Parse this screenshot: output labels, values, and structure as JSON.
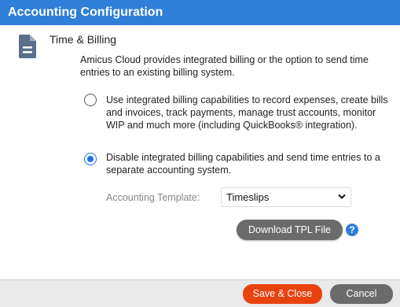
{
  "dialog": {
    "title": "Accounting Configuration"
  },
  "section": {
    "icon": "document-icon",
    "title": "Time & Billing",
    "description": "Amicus Cloud provides integrated billing or the option to send time entries to an existing billing system."
  },
  "options": [
    {
      "label": "Use integrated billing capabilities to record expenses, create bills and invoices, track payments, manage trust accounts, monitor WIP and much more (including QuickBooks® integration).",
      "selected": false
    },
    {
      "label": "Disable integrated billing capabilities and send time entries to a separate accounting system.",
      "selected": true
    }
  ],
  "template": {
    "label": "Accounting Template:",
    "value": "Timeslips"
  },
  "download_button": "Download TPL File",
  "help_icon": "?",
  "footer": {
    "save_label": "Save & Close",
    "cancel_label": "Cancel"
  },
  "colors": {
    "title_bar": "#2f7ed8",
    "save_button": "#e8420f",
    "gray_button": "#6b6b6b",
    "radio_selected": "#1a73e8"
  }
}
